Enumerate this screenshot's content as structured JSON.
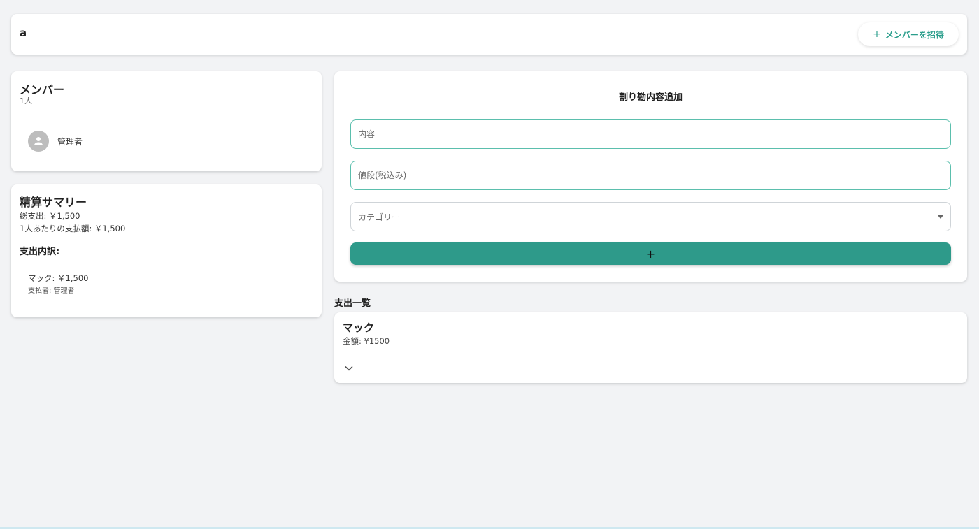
{
  "header": {
    "title": "a",
    "invite_plus": "+",
    "invite_label": "メンバーを招待"
  },
  "members": {
    "title": "メンバー",
    "count": "1人",
    "items": [
      {
        "name": "管理者",
        "icon": "person-icon"
      }
    ]
  },
  "summary": {
    "title": "精算サマリー",
    "total": "総支出: ￥1,500",
    "per_person": "1人あたりの支払額: ￥1,500",
    "breakdown_title": "支出内訳:",
    "breakdown": [
      {
        "item": "マック: ￥1,500",
        "payer": "支払者: 管理者"
      }
    ]
  },
  "form": {
    "title": "割り勘内容追加",
    "content_placeholder": "内容",
    "content_value": "",
    "price_placeholder": "値段(税込み)",
    "price_value": "",
    "category_placeholder": "カテゴリー",
    "add_label": "+"
  },
  "expenses": {
    "title": "支出一覧",
    "items": [
      {
        "name": "マック",
        "amount": "金額: ¥1500",
        "icon": "chevron-down-icon"
      }
    ]
  },
  "colors": {
    "accent": "#2e9a8a",
    "accent_text": "#2b9e8c",
    "field_border": "#5bbfad",
    "background": "#f2f3f5"
  }
}
